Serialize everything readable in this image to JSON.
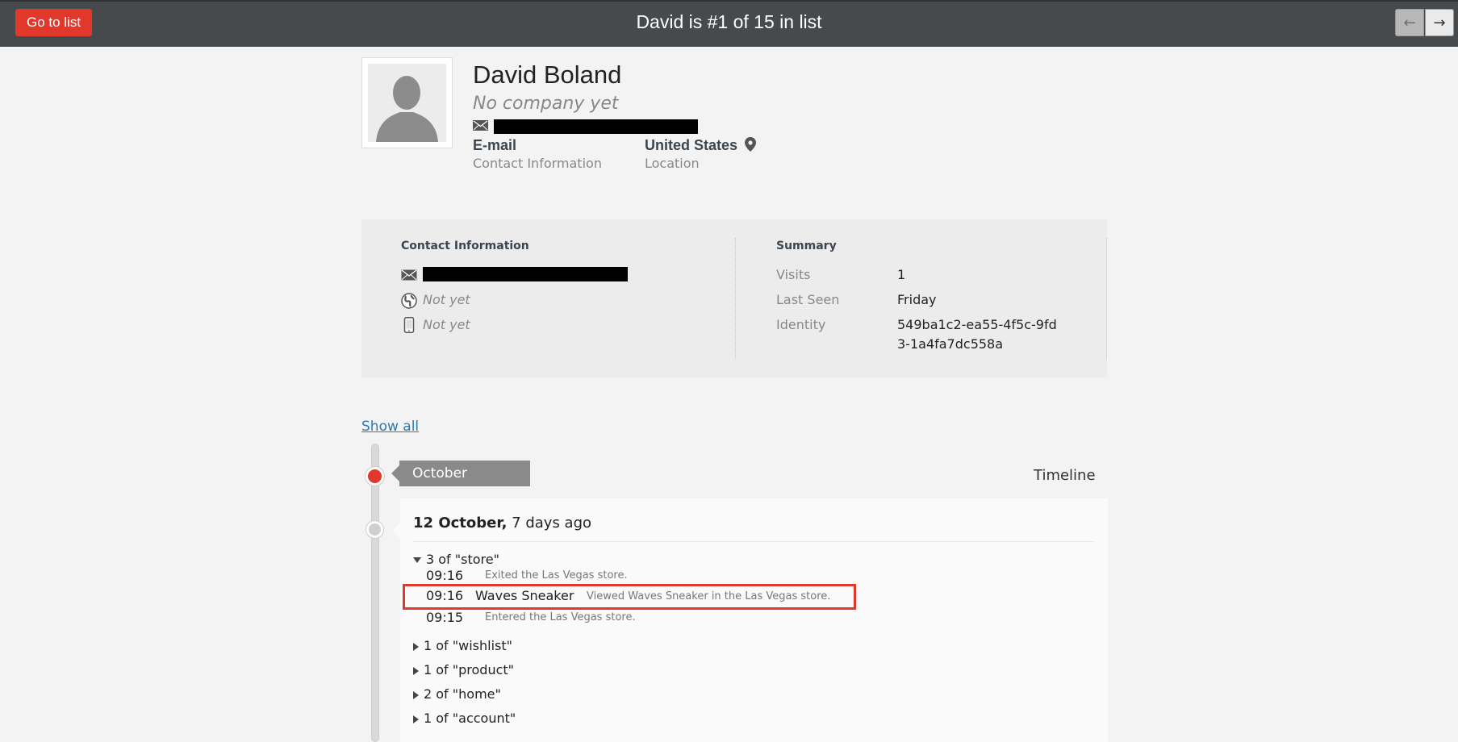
{
  "topbar": {
    "go_to_list": "Go to list",
    "title": "David is #1 of 15 in list",
    "prev_icon": "arrow-left-icon",
    "next_icon": "arrow-right-icon"
  },
  "profile": {
    "name": "David Boland",
    "company": "No company yet",
    "contact_value": "E-mail",
    "contact_label": "Contact Information",
    "location_value": "United States",
    "location_label": "Location"
  },
  "contact_info": {
    "heading": "Contact Information",
    "website": "Not yet",
    "phone": "Not yet"
  },
  "summary": {
    "heading": "Summary",
    "rows": [
      {
        "label": "Visits",
        "value": "1"
      },
      {
        "label": "Last Seen",
        "value": "Friday"
      },
      {
        "label": "Identity",
        "value": "549ba1c2-ea55-4f5c-9fd3-1a4fa7dc558a"
      }
    ]
  },
  "show_all": "Show all",
  "timeline": {
    "label": "Timeline",
    "month": "October",
    "day": {
      "date": "12 October,",
      "ago": "7 days ago"
    },
    "expanded_group": "3 of \"store\"",
    "events": [
      {
        "time": "09:16",
        "title": "",
        "desc": "Exited the Las Vegas store."
      },
      {
        "time": "09:16",
        "title": "Waves Sneaker",
        "desc": "Viewed Waves Sneaker in the Las Vegas store."
      },
      {
        "time": "09:15",
        "title": "",
        "desc": "Entered the Las Vegas store."
      }
    ],
    "collapsed_groups": [
      "1 of \"wishlist\"",
      "1 of \"product\"",
      "2 of \"home\"",
      "1 of \"account\""
    ]
  },
  "colors": {
    "accent": "#e2382b",
    "topbar": "#474a4c",
    "link": "#2b7ab3"
  }
}
